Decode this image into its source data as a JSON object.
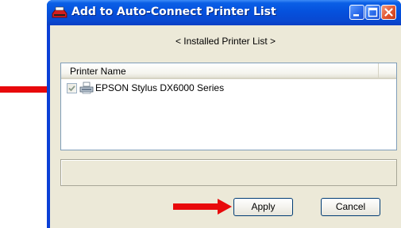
{
  "window": {
    "title": "Add to Auto-Connect Printer List",
    "icon": "printer-app-icon",
    "controls": [
      "minimize-icon",
      "maximize-icon",
      "close-icon"
    ]
  },
  "subtitle": "< Installed Printer List >",
  "printer_list": {
    "column_header": "Printer Name",
    "rows": [
      {
        "checked": true,
        "icon": "printer-icon",
        "label": "EPSON Stylus DX6000 Series"
      }
    ]
  },
  "buttons": {
    "apply": "Apply",
    "cancel": "Cancel"
  },
  "annotations": [
    {
      "name": "red-arrow",
      "points_to": "printer-checkbox",
      "color": "#e8090b"
    },
    {
      "name": "red-arrow",
      "points_to": "apply-button",
      "color": "#e8090b"
    }
  ],
  "colors": {
    "titlebar": "#0551dd",
    "dialog_face": "#ece9d8",
    "close_button": "#e2542e",
    "arrow": "#e8090b"
  }
}
